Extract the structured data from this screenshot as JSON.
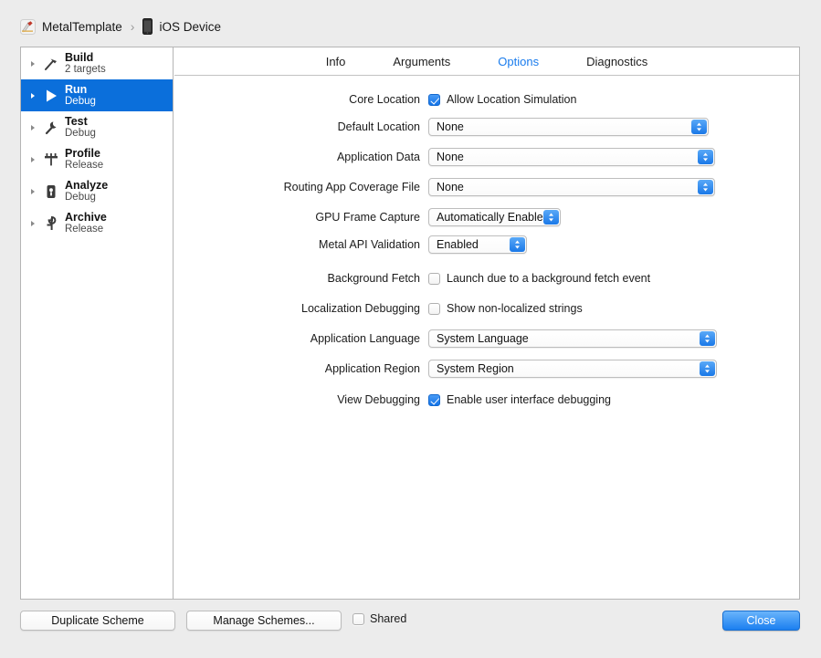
{
  "breadcrumb": {
    "app_icon": "xcode-app-icon",
    "project": "MetalTemplate",
    "separator": "›",
    "device_icon": "iphone-device-icon",
    "device": "iOS Device"
  },
  "sidebar": {
    "items": [
      {
        "title": "Build",
        "subtitle": "2 targets",
        "icon": "hammer-icon",
        "selected": false
      },
      {
        "title": "Run",
        "subtitle": "Debug",
        "icon": "play-icon",
        "selected": true
      },
      {
        "title": "Test",
        "subtitle": "Debug",
        "icon": "wrench-icon",
        "selected": false
      },
      {
        "title": "Profile",
        "subtitle": "Release",
        "icon": "gauge-icon",
        "selected": false
      },
      {
        "title": "Analyze",
        "subtitle": "Debug",
        "icon": "analyze-icon",
        "selected": false
      },
      {
        "title": "Archive",
        "subtitle": "Release",
        "icon": "archive-icon",
        "selected": false
      }
    ]
  },
  "tabs": [
    {
      "label": "Info",
      "active": false
    },
    {
      "label": "Arguments",
      "active": false
    },
    {
      "label": "Options",
      "active": true
    },
    {
      "label": "Diagnostics",
      "active": false
    }
  ],
  "options": {
    "core_location": {
      "label": "Core Location",
      "checkbox_label": "Allow Location Simulation",
      "checked": true
    },
    "default_location": {
      "label": "Default Location",
      "value": "None"
    },
    "application_data": {
      "label": "Application Data",
      "value": "None"
    },
    "routing_app_coverage_file": {
      "label": "Routing App Coverage File",
      "value": "None"
    },
    "gpu_frame_capture": {
      "label": "GPU Frame Capture",
      "value": "Automatically Enabled"
    },
    "metal_api_validation": {
      "label": "Metal API Validation",
      "value": "Enabled"
    },
    "background_fetch": {
      "label": "Background Fetch",
      "checkbox_label": "Launch due to a background fetch event",
      "checked": false
    },
    "localization_debugging": {
      "label": "Localization Debugging",
      "checkbox_label": "Show non-localized strings",
      "checked": false
    },
    "application_language": {
      "label": "Application Language",
      "value": "System Language"
    },
    "application_region": {
      "label": "Application Region",
      "value": "System Region"
    },
    "view_debugging": {
      "label": "View Debugging",
      "checkbox_label": "Enable user interface debugging",
      "checked": true
    }
  },
  "footer": {
    "duplicate_scheme": "Duplicate Scheme",
    "manage_schemes": "Manage Schemes...",
    "shared_label": "Shared",
    "shared_checked": false,
    "close": "Close"
  },
  "colors": {
    "accent_blue": "#1a7ced",
    "selection_blue": "#0b6fdb",
    "window_bg": "#ececec",
    "panel_bg": "#ffffff"
  }
}
